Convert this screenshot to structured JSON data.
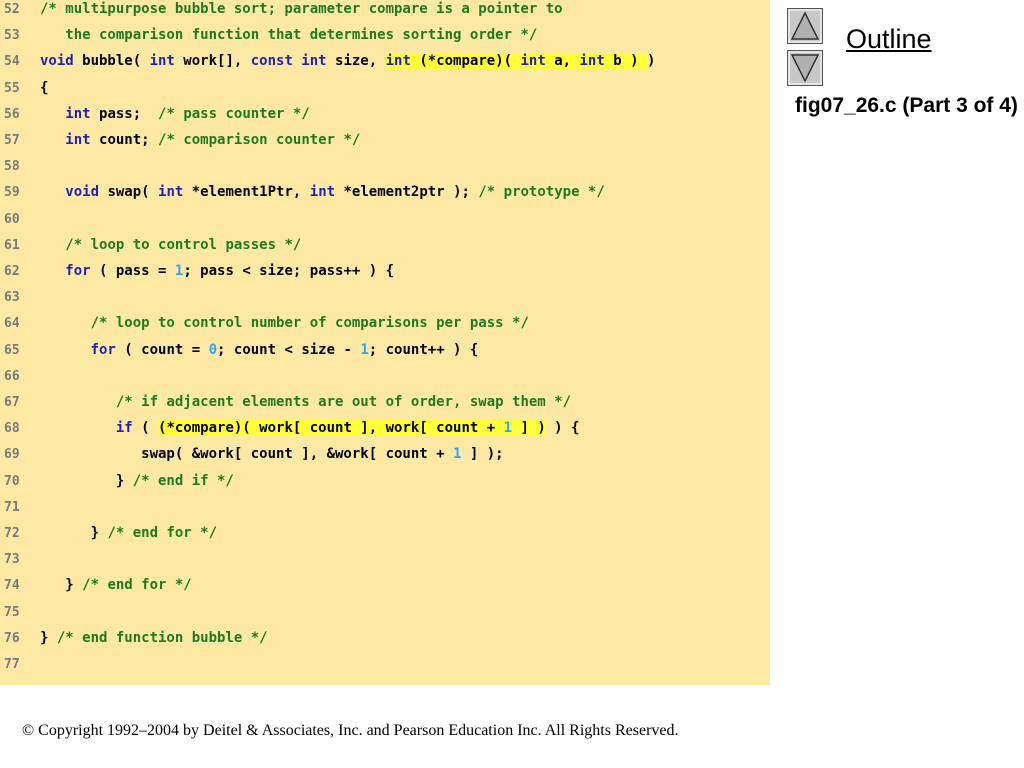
{
  "outline": {
    "title": "Outline",
    "figure_label": "fig07_26.c (Part 3 of 4)"
  },
  "footer": {
    "copyright": "© Copyright 1992–2004 by Deitel & Associates, Inc. and Pearson Education Inc. All Rights Reserved."
  },
  "icons": {
    "up": "triangle-up-icon",
    "down": "triangle-down-icon"
  },
  "colors": {
    "panel": "#fde9a4",
    "highlight": "#ffff3a",
    "comment": "#1e7a1e",
    "keyword": "#1f22b8",
    "number": "#2aa5ff"
  },
  "code": [
    {
      "n": "52",
      "tokens": [
        {
          "t": "/* multipurpose bubble sort; parameter compare is a pointer to",
          "c": "comment"
        }
      ]
    },
    {
      "n": "53",
      "tokens": [
        {
          "t": "   the comparison function that determines sorting order */",
          "c": "comment"
        }
      ]
    },
    {
      "n": "54",
      "tokens": [
        {
          "t": "void",
          "c": "keyword"
        },
        {
          "t": " bubble( ",
          "c": "plain"
        },
        {
          "t": "int",
          "c": "keyword"
        },
        {
          "t": " work[], ",
          "c": "plain"
        },
        {
          "t": "const int",
          "c": "keyword"
        },
        {
          "t": " size, ",
          "c": "plain"
        },
        {
          "t": "int",
          "c": "keyword",
          "h": true
        },
        {
          "t": " (*compare)( ",
          "c": "plain",
          "h": true
        },
        {
          "t": "int",
          "c": "keyword",
          "h": true
        },
        {
          "t": " a, ",
          "c": "plain",
          "h": true
        },
        {
          "t": "int",
          "c": "keyword",
          "h": true
        },
        {
          "t": " b ) ",
          "c": "plain",
          "h": true
        },
        {
          "t": ")",
          "c": "plain"
        }
      ]
    },
    {
      "n": "55",
      "tokens": [
        {
          "t": "{",
          "c": "plain"
        }
      ]
    },
    {
      "n": "56",
      "tokens": [
        {
          "t": "   ",
          "c": "plain"
        },
        {
          "t": "int",
          "c": "keyword"
        },
        {
          "t": " pass;  ",
          "c": "plain"
        },
        {
          "t": "/* pass counter */",
          "c": "comment"
        }
      ]
    },
    {
      "n": "57",
      "tokens": [
        {
          "t": "   ",
          "c": "plain"
        },
        {
          "t": "int",
          "c": "keyword"
        },
        {
          "t": " count; ",
          "c": "plain"
        },
        {
          "t": "/* comparison counter */",
          "c": "comment"
        }
      ]
    },
    {
      "n": "58",
      "tokens": []
    },
    {
      "n": "59",
      "tokens": [
        {
          "t": "   ",
          "c": "plain"
        },
        {
          "t": "void",
          "c": "keyword"
        },
        {
          "t": " swap( ",
          "c": "plain"
        },
        {
          "t": "int",
          "c": "keyword"
        },
        {
          "t": " *element1Ptr, ",
          "c": "plain"
        },
        {
          "t": "int",
          "c": "keyword"
        },
        {
          "t": " *element2ptr ); ",
          "c": "plain"
        },
        {
          "t": "/* prototype */",
          "c": "comment"
        }
      ]
    },
    {
      "n": "60",
      "tokens": []
    },
    {
      "n": "61",
      "tokens": [
        {
          "t": "   ",
          "c": "plain"
        },
        {
          "t": "/* loop to control passes */",
          "c": "comment"
        }
      ]
    },
    {
      "n": "62",
      "tokens": [
        {
          "t": "   ",
          "c": "plain"
        },
        {
          "t": "for",
          "c": "keyword"
        },
        {
          "t": " ( pass = ",
          "c": "plain"
        },
        {
          "t": "1",
          "c": "number"
        },
        {
          "t": "; pass < size; pass++ ) {",
          "c": "plain"
        }
      ]
    },
    {
      "n": "63",
      "tokens": []
    },
    {
      "n": "64",
      "tokens": [
        {
          "t": "      ",
          "c": "plain"
        },
        {
          "t": "/* loop to control number of comparisons per pass */",
          "c": "comment"
        }
      ]
    },
    {
      "n": "65",
      "tokens": [
        {
          "t": "      ",
          "c": "plain"
        },
        {
          "t": "for",
          "c": "keyword"
        },
        {
          "t": " ( count = ",
          "c": "plain"
        },
        {
          "t": "0",
          "c": "number"
        },
        {
          "t": "; count < size - ",
          "c": "plain"
        },
        {
          "t": "1",
          "c": "number"
        },
        {
          "t": "; count++ ) {",
          "c": "plain"
        }
      ]
    },
    {
      "n": "66",
      "tokens": []
    },
    {
      "n": "67",
      "tokens": [
        {
          "t": "         ",
          "c": "plain"
        },
        {
          "t": "/* if adjacent elements are out of order, swap them */",
          "c": "comment"
        }
      ]
    },
    {
      "n": "68",
      "tokens": [
        {
          "t": "         ",
          "c": "plain"
        },
        {
          "t": "if",
          "c": "keyword"
        },
        {
          "t": " ( ",
          "c": "plain"
        },
        {
          "t": "(*compare)( work[ count ], work[ count + ",
          "c": "plain",
          "h": true
        },
        {
          "t": "1",
          "c": "number",
          "h": true
        },
        {
          "t": " ] )",
          "c": "plain",
          "h": true
        },
        {
          "t": " ) {",
          "c": "plain"
        }
      ]
    },
    {
      "n": "69",
      "tokens": [
        {
          "t": "            swap( &work[ count ], &work[ count + ",
          "c": "plain"
        },
        {
          "t": "1",
          "c": "number"
        },
        {
          "t": " ] );",
          "c": "plain"
        }
      ]
    },
    {
      "n": "70",
      "tokens": [
        {
          "t": "         } ",
          "c": "plain"
        },
        {
          "t": "/* end if */",
          "c": "comment"
        }
      ]
    },
    {
      "n": "71",
      "tokens": []
    },
    {
      "n": "72",
      "tokens": [
        {
          "t": "      } ",
          "c": "plain"
        },
        {
          "t": "/* end for */",
          "c": "comment"
        }
      ]
    },
    {
      "n": "73",
      "tokens": []
    },
    {
      "n": "74",
      "tokens": [
        {
          "t": "   } ",
          "c": "plain"
        },
        {
          "t": "/* end for */",
          "c": "comment"
        }
      ]
    },
    {
      "n": "75",
      "tokens": []
    },
    {
      "n": "76",
      "tokens": [
        {
          "t": "} ",
          "c": "plain"
        },
        {
          "t": "/* end function bubble */",
          "c": "comment"
        }
      ]
    },
    {
      "n": "77",
      "tokens": []
    }
  ]
}
